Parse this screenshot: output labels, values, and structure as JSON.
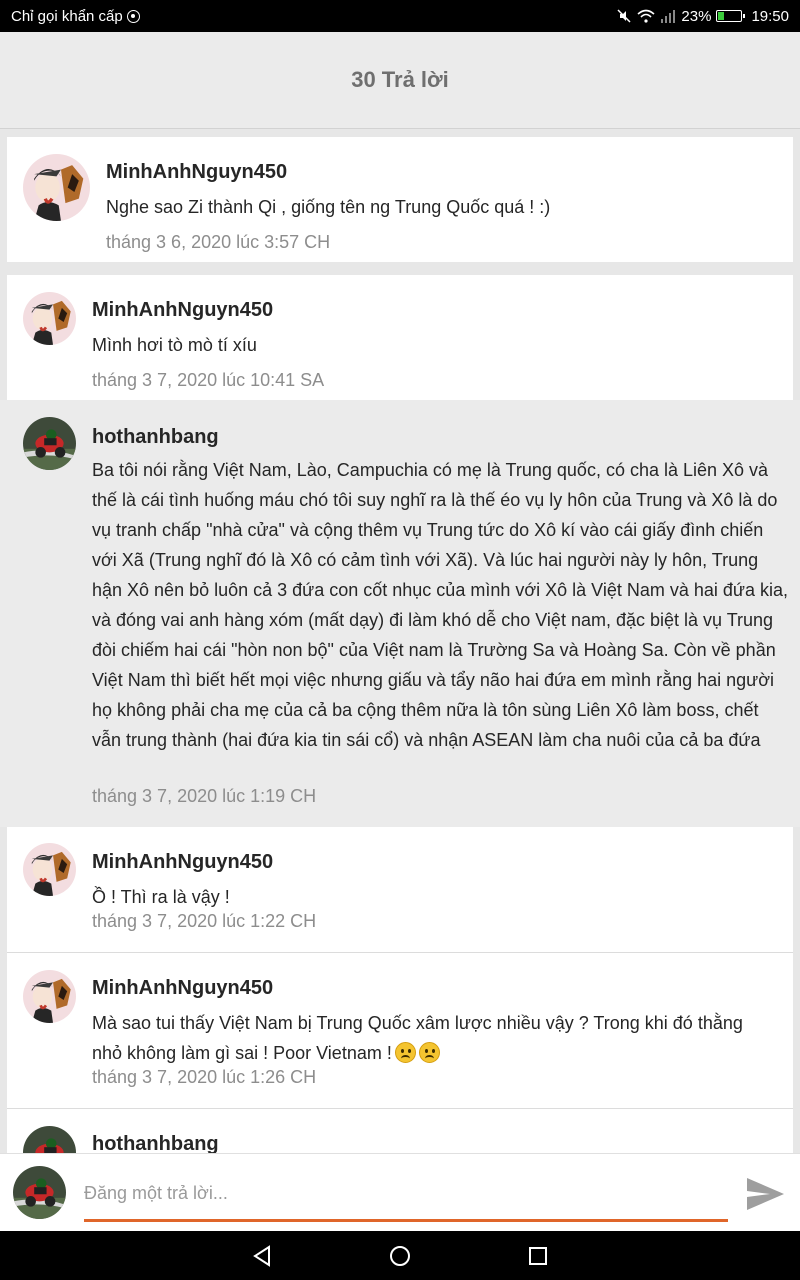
{
  "status_bar": {
    "carrier": "Chỉ gọi khẩn cấp",
    "battery": "23%",
    "time": "19:50",
    "battery_level": 0.23,
    "icons": [
      "emergency-icon",
      "mute-icon",
      "wifi-icon",
      "signal-icon",
      "battery-icon"
    ]
  },
  "header": {
    "title": "30 Trả lời"
  },
  "replies": [
    {
      "user": "MinhAnhNguyn450",
      "text": "Nghe sao Zi thành Qi , giống tên ng Trung Quốc quá ! :)",
      "time": "tháng 3 6, 2020 lúc 3:57 CH",
      "avatar": "anime-avatar",
      "highlighted": false
    },
    {
      "user": "MinhAnhNguyn450",
      "text": "Mình hơi tò mò tí xíu",
      "time": "tháng 3 7, 2020 lúc 10:41 SA",
      "avatar": "anime-avatar",
      "highlighted": false
    },
    {
      "user": "hothanhbang",
      "text": "Ba tôi nói rằng Việt Nam, Lào, Campuchia có mẹ là Trung quốc, có cha là Liên Xô và thế là cái tình huống máu chó tôi suy nghĩ ra là thế éo vụ ly hôn của Trung và Xô là do vụ tranh chấp \"nhà cửa\" và cộng thêm vụ Trung tức do  Xô kí vào cái giấy đình chiến với Xã (Trung nghĩ đó là Xô có cảm tình với Xã). Và lúc hai người này ly hôn, Trung hận Xô nên bỏ luôn cả 3 đứa con cốt  nhục của mình với Xô là Việt Nam và hai đứa kia, và đóng vai anh hàng xóm (mất dạy) đi làm khó dễ cho Việt nam, đặc biệt là vụ Trung đòi chiếm hai cái \"hòn non bộ\" của Việt nam là Trường Sa và Hoàng Sa. Còn về phần Việt Nam thì biết hết mọi việc nhưng giấu và tẩy não hai đứa em mình rằng hai người họ không phải cha mẹ của cả ba cộng thêm nữa là tôn sùng Liên Xô làm boss, chết vẫn trung thành (hai đứa kia tin sái cổ)  và nhận ASEAN làm cha nuôi của cả ba đứa",
      "time": "tháng 3 7, 2020 lúc 1:19 CH",
      "avatar": "motorcycle-avatar",
      "highlighted": true
    },
    {
      "user": "MinhAnhNguyn450",
      "text": "Ồ ! Thì ra là vậy !",
      "time": "tháng 3 7, 2020 lúc 1:22 CH",
      "avatar": "anime-avatar",
      "highlighted": false
    },
    {
      "user": "MinhAnhNguyn450",
      "text": "Mà sao tui thấy Việt Nam bị Trung Quốc xâm lược nhiều vậy ? Trong khi đó thằng nhỏ không làm gì sai ! Poor Vietnam !",
      "emoji": [
        "frown-emoji",
        "frown-emoji"
      ],
      "time": "tháng 3 7, 2020 lúc 1:26 CH",
      "avatar": "anime-avatar",
      "highlighted": false
    },
    {
      "user": "hothanhbang",
      "text": "",
      "time": "",
      "avatar": "motorcycle-avatar",
      "highlighted": false
    }
  ],
  "composer": {
    "placeholder": "Đăng một trả lời...",
    "value": "",
    "send_icon": "send-icon"
  },
  "nav_bar": {
    "buttons": [
      "back-icon",
      "home-icon",
      "recents-icon"
    ]
  },
  "colors": {
    "accent": "#e0662a",
    "header_bg": "#ebebeb",
    "highlight_bg": "#ebebeb",
    "timestamp": "#8d8d8d"
  }
}
